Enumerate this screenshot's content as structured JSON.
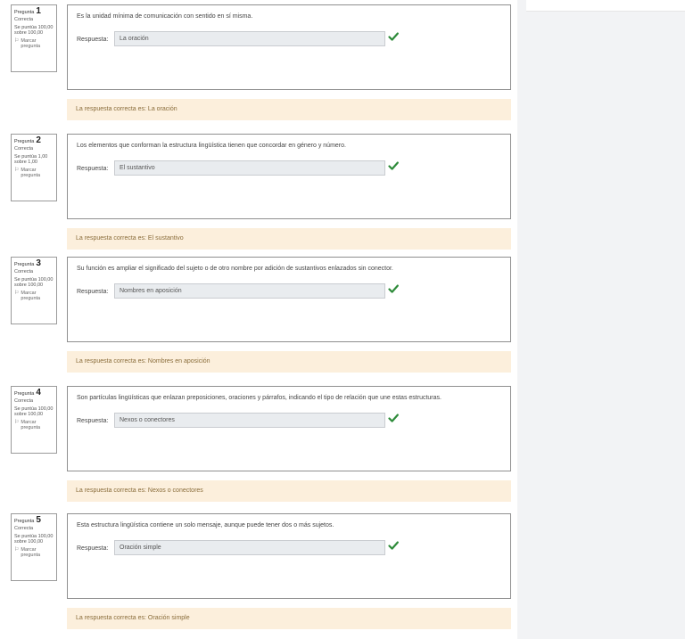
{
  "colors": {
    "correct_check": "#2e8b3a",
    "feedback_bg": "#fcefdc",
    "feedback_text": "#8a6d3b",
    "answer_bg": "#e9ecef"
  },
  "icons": {
    "flag": "flag-icon",
    "check": "check-icon"
  },
  "answer_label": "Respuesta:",
  "questions": [
    {
      "word": "Pregunta",
      "number": "1",
      "state": "Correcta",
      "grade": "Se puntúa 100,00 sobre 100,00",
      "flag": "Marcar pregunta",
      "text": "Es la unidad mínima de comunicación con sentido en sí misma.",
      "answer": "La oración",
      "feedback": "La respuesta correcta es: La oración"
    },
    {
      "word": "Pregunta",
      "number": "2",
      "state": "Correcta",
      "grade": "Se puntúa 1,00 sobre 1,00",
      "flag": "Marcar pregunta",
      "text": "Los elementos que conforman la estructura lingüística tienen que concordar en género y número.",
      "answer": "El sustantivo",
      "feedback": "La respuesta correcta es: El sustantivo"
    },
    {
      "word": "Pregunta",
      "number": "3",
      "state": "Correcta",
      "grade": "Se puntúa 100,00 sobre 100,00",
      "flag": "Marcar pregunta",
      "text": "Su función es ampliar el significado del sujeto o de otro nombre por adición de sustantivos enlazados sin conector.",
      "answer": "Nombres en aposición",
      "feedback": "La respuesta correcta es: Nombres en aposición"
    },
    {
      "word": "Pregunta",
      "number": "4",
      "state": "Correcta",
      "grade": "Se puntúa 100,00 sobre 100,00",
      "flag": "Marcar pregunta",
      "text": "Son partículas lingüísticas que enlazan preposiciones, oraciones y párrafos, indicando el tipo de relación que une estas estructuras.",
      "answer": "Nexos o conectores",
      "feedback": "La respuesta correcta es: Nexos o conectores"
    },
    {
      "word": "Pregunta",
      "number": "5",
      "state": "Correcta",
      "grade": "Se puntúa 100,00 sobre 100,00",
      "flag": "Marcar pregunta",
      "text": "Esta estructura lingüística contiene un solo mensaje, aunque puede tener dos o más sujetos.",
      "answer": "Oración simple",
      "feedback": "La respuesta correcta es: Oración simple"
    }
  ]
}
